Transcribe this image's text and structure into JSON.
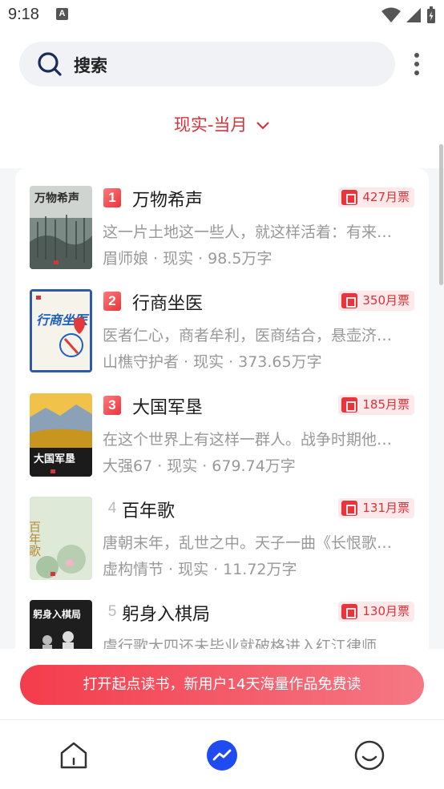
{
  "status_bar": {
    "time": "9:18",
    "badge": "A"
  },
  "search": {
    "label": "搜索"
  },
  "filter": {
    "label": "现实-当月"
  },
  "books": [
    {
      "rank": "1",
      "title": "万物希声",
      "votes": "427月票",
      "desc": "这一片土地这一些人，就这样活着：有来…",
      "author": "眉师娘",
      "genre": "现实",
      "words": "98.5万字",
      "cover_title": "万物希声"
    },
    {
      "rank": "2",
      "title": "行商坐医",
      "votes": "350月票",
      "desc": "医者仁心，商者牟利，医商结合，悬壶济…",
      "author": "山樵守护者",
      "genre": "现实",
      "words": "373.65万字",
      "cover_title": "行商坐医"
    },
    {
      "rank": "3",
      "title": "大国军垦",
      "votes": "185月票",
      "desc": "在这个世界上有这样一群人。战争时期他…",
      "author": "大强67",
      "genre": "现实",
      "words": "679.74万字",
      "cover_title": "大国军垦"
    },
    {
      "rank": "4",
      "title": "百年歌",
      "votes": "131月票",
      "desc": "唐朝末年，乱世之中。天子一曲《长恨歌…",
      "author": "虚构情节",
      "genre": "现实",
      "words": "11.72万字",
      "cover_title": "百年歌"
    },
    {
      "rank": "5",
      "title": "躬身入棋局",
      "votes": "130月票",
      "desc": "虞行歌大四还未毕业就破格进入红江律师…",
      "author": "",
      "genre": "",
      "words": "",
      "cover_title": "躬身入棋局"
    }
  ],
  "meta_separator": "·",
  "cta": {
    "label": "打开起点读书，新用户14天海量作品免费读"
  },
  "colors": {
    "accent": "#d8323a",
    "tab_active": "#1f4bf0"
  },
  "tabs": [
    {
      "icon": "home-icon"
    },
    {
      "icon": "trending-icon"
    },
    {
      "icon": "profile-icon"
    }
  ]
}
